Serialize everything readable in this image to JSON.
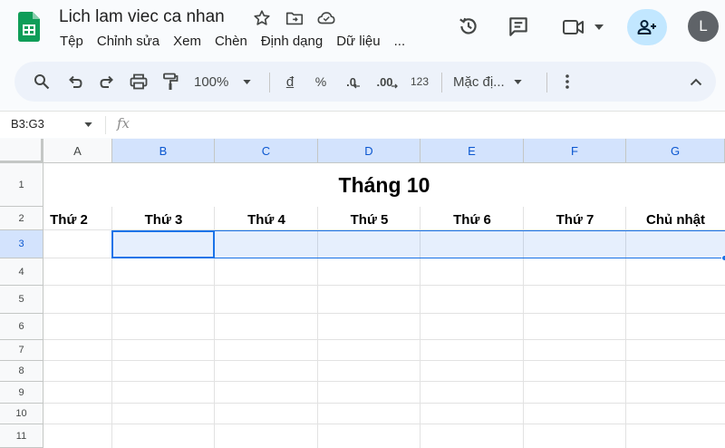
{
  "doc": {
    "title": "Lich lam viec ca nhan"
  },
  "menu": [
    "Tệp",
    "Chỉnh sửa",
    "Xem",
    "Chèn",
    "Định dạng",
    "Dữ liệu",
    "..."
  ],
  "account": {
    "initial": "L"
  },
  "toolbar": {
    "zoom": "100%",
    "currency": "đ",
    "percent": "%",
    "decrease_decimal": ".0",
    "increase_decimal": ".00",
    "number_format": "123",
    "font": "Mặc đị..."
  },
  "formula_bar": {
    "name_box": "B3:G3",
    "fx": "fx",
    "value": ""
  },
  "sheet": {
    "columns": [
      "A",
      "B",
      "C",
      "D",
      "E",
      "F",
      "G"
    ],
    "rows": [
      "1",
      "2",
      "3",
      "4",
      "5",
      "6",
      "7",
      "8",
      "9",
      "10",
      "11"
    ],
    "title_cell": "Tháng 10",
    "weekdays": [
      "Thứ 2",
      "Thứ 3",
      "Thứ 4",
      "Thứ 5",
      "Thứ 6",
      "Thứ 7",
      "Chủ nhật"
    ],
    "selected_columns": [
      "B",
      "C",
      "D",
      "E",
      "F",
      "G"
    ],
    "selected_row": "3"
  },
  "colors": {
    "accent": "#1a73e8",
    "header_selected": "#d3e3fd",
    "toolbar_bg": "#edf2fa",
    "share_bg": "#c2e7ff",
    "sheets_green": "#0f9d58"
  }
}
